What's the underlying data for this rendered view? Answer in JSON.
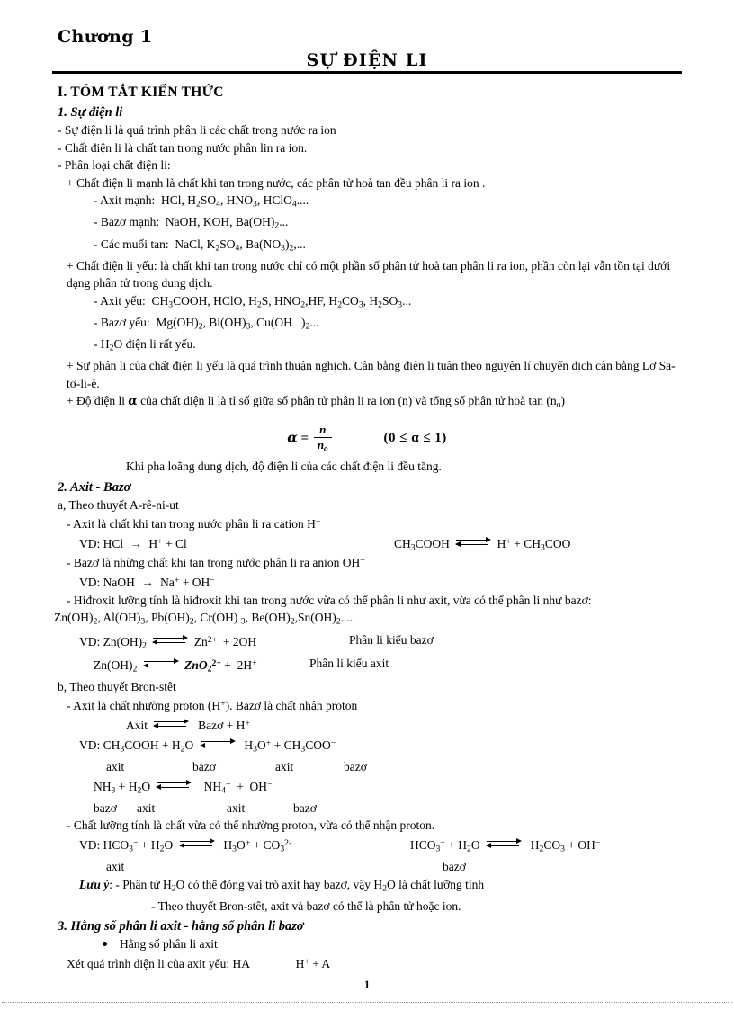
{
  "document": {
    "chapter": "Chương 1",
    "title": "SỰ ĐIỆN LI",
    "page_number": "1"
  },
  "sections": {
    "heading_1": "I. TÓM TẮT KIẾN THỨC",
    "sub_1": {
      "heading": "1. Sự điện li",
      "l1": "- Sự điện li là quá trình phân li các chất trong nước ra ion",
      "l2": "- Chất điện li là chất tan trong nước phân lin ra ion.",
      "l3": "- Phân loại chất điện li:",
      "strong": {
        "lead": "+ Chất điện li mạnh là chất khi tan trong nước, các phân tử hoà tan đều phân li ra ion .",
        "acid_label": "- Axit mạnh:",
        "acid_list_pre": "HCl, H",
        "base_label": "- Bazơ mạnh:",
        "salt_label": "- Các muối tan:"
      },
      "weak": {
        "lead": "+ Chất điện li yếu: là chất khi tan trong nước chỉ có một phần số phân tử hoà tan phân li ra ion, phần còn lại vẫn tồn tại dưới dạng phân tử trong dung dịch.",
        "acid_label": "- Axit yếu:",
        "base_label": "- Bazơ yếu:",
        "water_line": "điện li rất yếu."
      },
      "reversible": "+ Sự phân li của chất điện li yếu là quá trình thuận nghịch. Cân bằng điện li tuân theo nguyên lí chuyển dịch cân bằng Lơ Sa-tơ-li-ê.",
      "degree_lead_a": "+ Độ điện li",
      "degree_lead_b": "của chất điện li là tỉ số giữa số phân tử phân li ra ion (n) và tổng số phân tử hoà tan (n",
      "formula": {
        "alpha": "α",
        "equals": "=",
        "numerator": "n",
        "denominator": "n",
        "denominator_sub": "o",
        "condition": "(0 ≤ α ≤ 1)"
      },
      "dilute_note": "Khi pha loãng dung dịch, độ điện li của các chất điện li đều tăng."
    },
    "sub_2": {
      "heading": "2. Axit - Bazơ",
      "a_heading": "a, Theo thuyết A-rê-ni-ut",
      "acid_def": "- Axit là chất khi tan trong nước phân li ra cation H",
      "acid_vd_left": "VD:   HCl",
      "acid_vd_left_rest": "H",
      "acid_vd_right_pre": "CH",
      "base_def": "- Bazơ là những chất khi tan trong nước phân li ra anion OH",
      "base_vd": "VD:  NaOH",
      "amphoteric_def": "- Hiđroxit lưỡng tính là hiđroxit khi tan trong nước vừa có thể phân li như axit, vừa có thể phân li như bazơ:",
      "amphoteric_list_end": "....",
      "zn_base_note": "Phân li kiểu bazơ",
      "zn_acid_note": "Phân li kiểu axit",
      "b_heading": "b, Theo thuyết Bron-stêt",
      "bronsted_def": "- Axit là chất nhường proton (H",
      "bronsted_def_2": "). Bazơ là chất nhận proton",
      "axit_word": "Axit",
      "bazo_word": "Bazơ",
      "label_axit": "axit",
      "label_bazo": "bazơ",
      "amphoteric_substance": "- Chất lưỡng tính là chất vừa có thể nhường proton, vừa có thể nhận proton.",
      "note_label": "Lưu ý",
      "note_1_pre": ": - Phân tử H",
      "note_1_mid": "O có thể đóng vai trò axit hay bazơ, vậy H",
      "note_1_end": "O là chất lưỡng tính",
      "note_2": "- Theo thuyết Bron-stêt, axit và bazơ có thể là phân tử hoặc ion."
    },
    "sub_3": {
      "heading": "3. Hằng số phân li axit - hằng số phân li bazơ",
      "bullet": "Hằng số phân li axit",
      "line": "Xét quá trình điện li của axit yếu:  HA",
      "products_pre": "H"
    }
  }
}
